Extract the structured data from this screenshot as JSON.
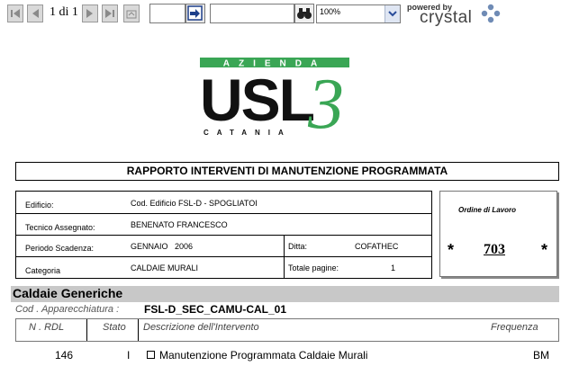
{
  "toolbar": {
    "page_indicator": "1 di 1",
    "page_input_value": "",
    "search_input_value": "",
    "zoom_value": "100%",
    "powered_by": "powered by",
    "brand": "crystal",
    "icons": [
      "first-page-icon",
      "prev-page-icon",
      "next-page-icon",
      "last-page-icon",
      "close-page-icon",
      "go-to-page-icon",
      "binoculars-icon",
      "chevron-down-icon"
    ]
  },
  "logo": {
    "top_text": "AZIENDA",
    "main_text": "USL",
    "numeral": "3",
    "bottom_text": "CATANIA",
    "colors": {
      "green": "#3aa655",
      "dark": "#111111"
    }
  },
  "report": {
    "title": "RAPPORTO INTERVENTI DI MANUTENZIONE PROGRAMMATA",
    "fields": {
      "edificio_label": "Edificio:",
      "edificio_value": "Cod. Edificio FSL-D - SPOGLIATOI",
      "tecnico_label": "Tecnico Assegnato:",
      "tecnico_value": "BENENATO FRANCESCO",
      "periodo_label": "Periodo Scadenza:",
      "periodo_value": "GENNAIO   2006",
      "ditta_label": "Ditta:",
      "ditta_value": "COFATHEC",
      "categoria_label": "Categoria",
      "categoria_value": "CALDAIE MURALI",
      "pagine_label": "Totale pagine:",
      "pagine_value": "1"
    },
    "order": {
      "label": "Ordine di Lavoro",
      "star": "*",
      "number": "703"
    },
    "section_title": "Caldaie Generiche",
    "cod_label": "Cod . Apparecchiatura :",
    "cod_value": "FSL-D_SEC_CAMU-CAL_01",
    "table": {
      "headers": [
        "N . RDL",
        "Stato",
        "Descrizione dell'Intervento",
        "Frequenza"
      ],
      "rows": [
        {
          "rdl": "146",
          "stato": "I",
          "descrizione": "Manutenzione Programmata Caldaie Murali",
          "frequenza": "BM"
        }
      ]
    }
  }
}
